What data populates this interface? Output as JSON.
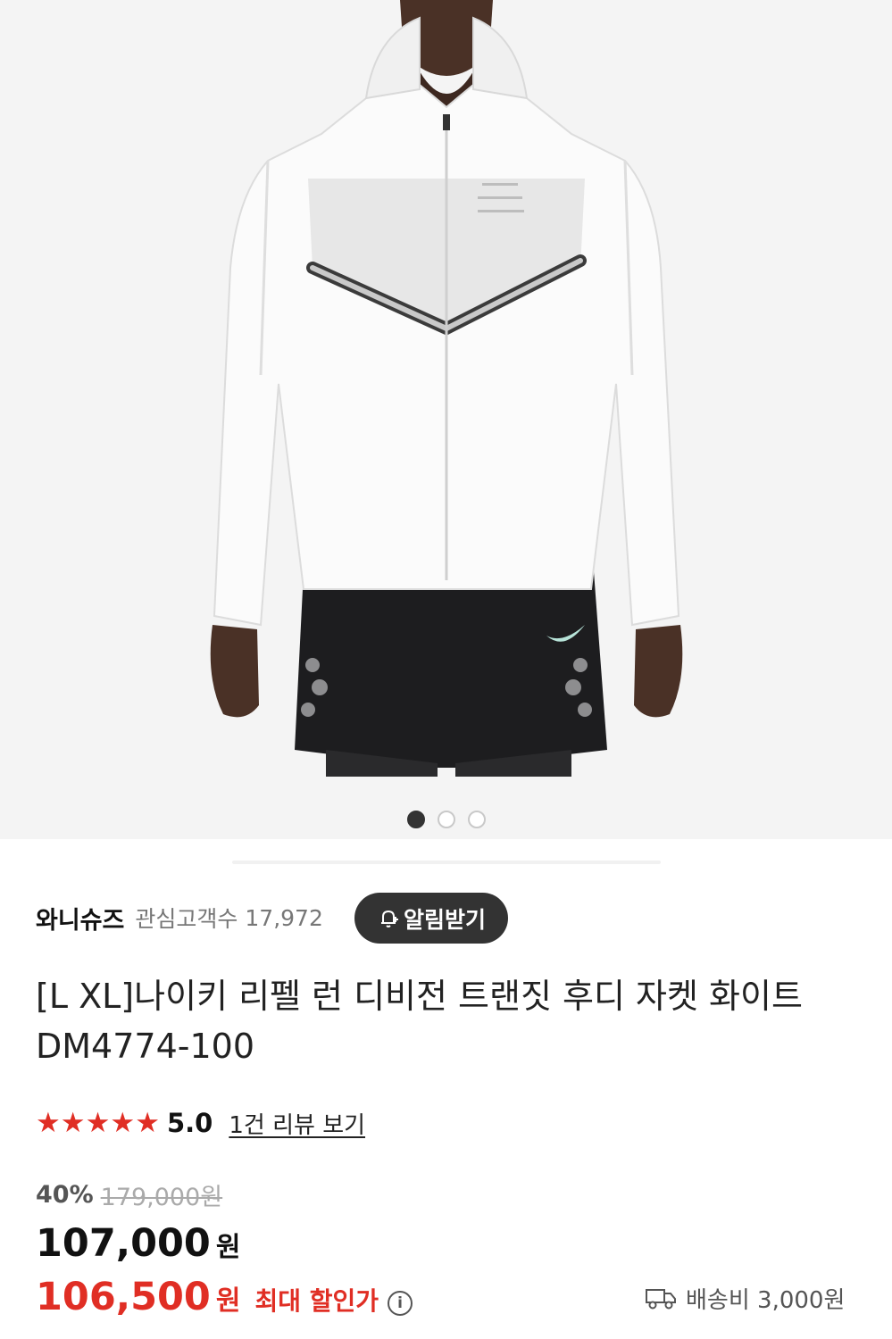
{
  "gallery": {
    "image_alt": "white running hoodie jacket product photo",
    "slide_count": 3,
    "active_slide": 1
  },
  "seller": {
    "name": "와니슈즈",
    "interest_label": "관심고객수",
    "interest_count": "17,972",
    "alert_button": "알림받기"
  },
  "product": {
    "title_line1": "[L XL]나이키 리펠 런 디비전 트랜짓 후디 자켓 화이트",
    "title_line2": "DM4774-100"
  },
  "rating": {
    "stars": 5,
    "score": "5.0",
    "review_link": "1건 리뷰 보기"
  },
  "price": {
    "discount_rate": "40%",
    "original_price": "179,000원",
    "sale_price": "107,000",
    "currency": "원",
    "max_discount_price": "106,500",
    "max_discount_label": "최대 할인가"
  },
  "shipping": {
    "label": "배송비 3,000원"
  },
  "colors": {
    "accent_red": "#e02e24",
    "button_dark": "#333333"
  }
}
